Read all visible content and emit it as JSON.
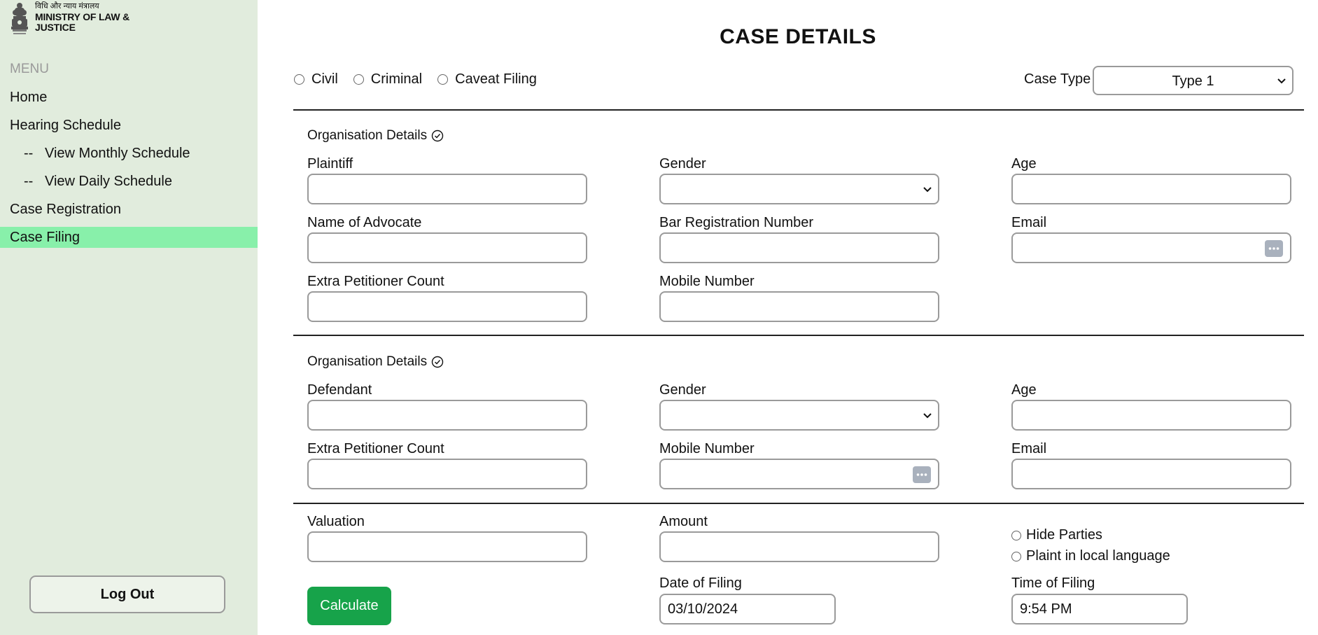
{
  "sidebar": {
    "logo_hindi": "विधि और न्याय मंत्रालय",
    "logo_line1": "MINISTRY OF LAW &",
    "logo_line2": "JUSTICE",
    "menu_heading": "MENU",
    "items": [
      {
        "label": "Home"
      },
      {
        "label": "Hearing Schedule"
      },
      {
        "label": "View Monthly Schedule",
        "prefix": "--"
      },
      {
        "label": "View Daily Schedule",
        "prefix": "--"
      },
      {
        "label": "Case Registration"
      },
      {
        "label": "Case Filing",
        "active": true
      }
    ],
    "logout_label": "Log Out",
    "bg_color": "#e1ecdd",
    "active_color": "#88f0aa"
  },
  "main": {
    "title": "CASE DETAILS",
    "filing_options": [
      "Civil",
      "Criminal",
      "Caveat Filing"
    ],
    "case_type_label": "Case Type",
    "case_type_value": "Type 1",
    "plaintiff_section": {
      "heading": "Organisation Details",
      "fields": {
        "plaintiff": "Plaintiff",
        "gender": "Gender",
        "age": "Age",
        "advocate": "Name of Advocate",
        "bar_reg": "Bar Registration Number",
        "email": "Email",
        "extra_count": "Extra Petitioner Count",
        "mobile": "Mobile Number"
      }
    },
    "defendant_section": {
      "heading": "Organisation Details",
      "fields": {
        "defendant": "Defendant",
        "gender": "Gender",
        "age": "Age",
        "extra_count": "Extra Petitioner Count",
        "mobile": "Mobile Number",
        "email": "Email"
      }
    },
    "filing_section": {
      "valuation": "Valuation",
      "amount": "Amount",
      "hide_parties": "Hide Parties",
      "plaint_local": "Plaint in local language",
      "calculate_label": "Calculate",
      "date_label": "Date of Filing",
      "date_value": "03/10/2024",
      "time_label": "Time of Filing",
      "time_value": "9:54 PM",
      "button_color": "#17a34a"
    }
  }
}
